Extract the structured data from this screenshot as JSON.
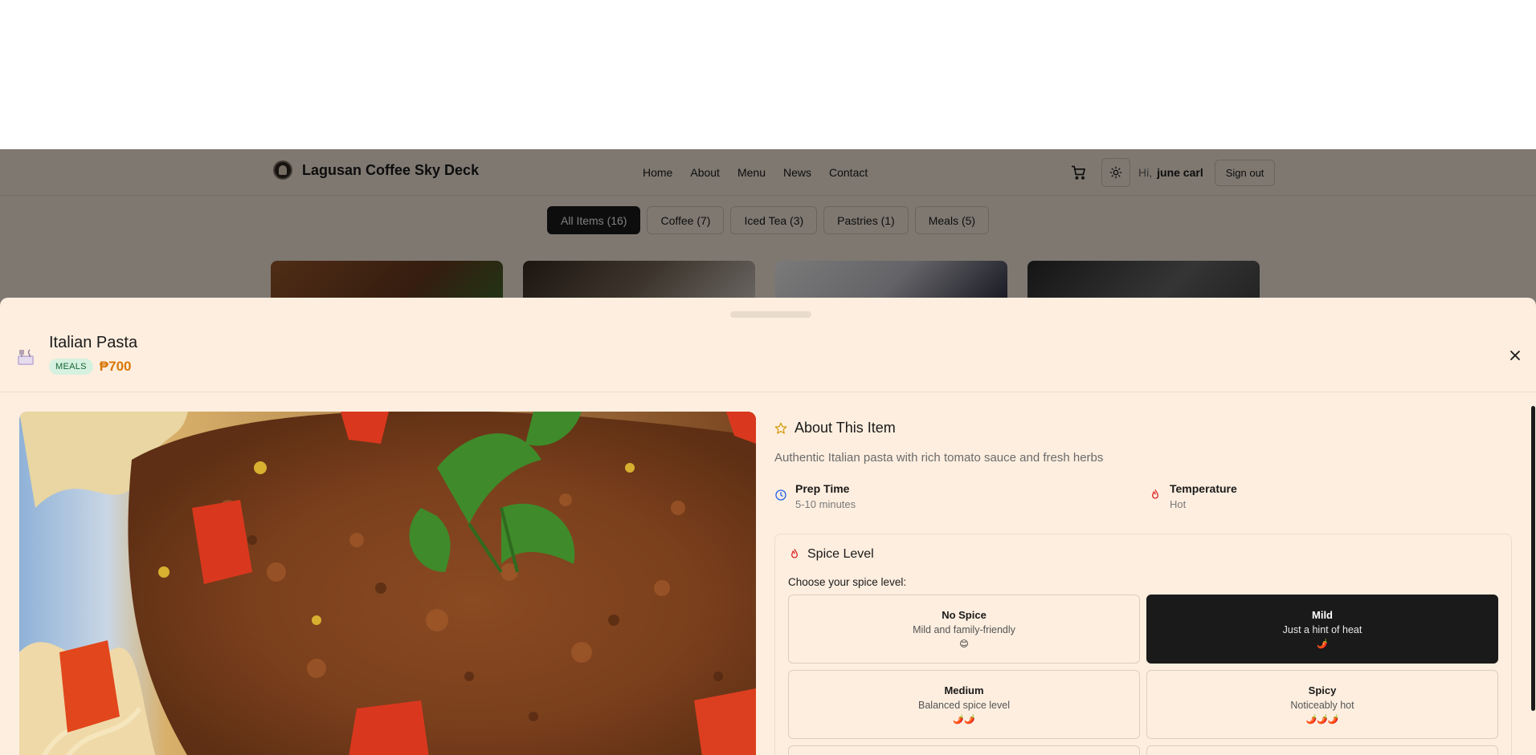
{
  "app": {
    "brand_name": "Lagusan Coffee Sky Deck",
    "nav": [
      "Home",
      "About",
      "Menu",
      "News",
      "Contact"
    ],
    "greeting": "Hi,",
    "username": "june carl",
    "sign_out": "Sign out"
  },
  "filters": [
    {
      "label": "All Items (16)",
      "active": true
    },
    {
      "label": "Coffee (7)",
      "active": false
    },
    {
      "label": "Iced Tea (3)",
      "active": false
    },
    {
      "label": "Pastries (1)",
      "active": false
    },
    {
      "label": "Meals (5)",
      "active": false
    }
  ],
  "item": {
    "title": "Italian Pasta",
    "category": "MEALS",
    "price": "₱700",
    "about_heading": "About This Item",
    "description": "Authentic Italian pasta with rich tomato sauce and fresh herbs",
    "prep_label": "Prep Time",
    "prep_value": "5-10 minutes",
    "temp_label": "Temperature",
    "temp_value": "Hot"
  },
  "spice": {
    "heading": "Spice Level",
    "prompt": "Choose your spice level:",
    "selected": "Mild",
    "options": [
      {
        "name": "No Spice",
        "desc": "Mild and family-friendly",
        "emoji": "😊"
      },
      {
        "name": "Mild",
        "desc": "Just a hint of heat",
        "emoji": "🌶️"
      },
      {
        "name": "Medium",
        "desc": "Balanced spice level",
        "emoji": "🌶️🌶️"
      },
      {
        "name": "Spicy",
        "desc": "Noticeably hot",
        "emoji": "🌶️🌶️🌶️"
      }
    ]
  },
  "icons": {
    "cart": "cart-icon",
    "theme": "sun-icon",
    "close": "close-icon",
    "star": "star-icon",
    "clock": "clock-icon",
    "flame": "flame-icon",
    "meal": "utensils-icon"
  },
  "colors": {
    "sheet_bg": "#fdeedf",
    "price": "#d97706",
    "badge_bg": "#d6f1df",
    "badge_text": "#166534",
    "selected": "#1a1a1a"
  }
}
